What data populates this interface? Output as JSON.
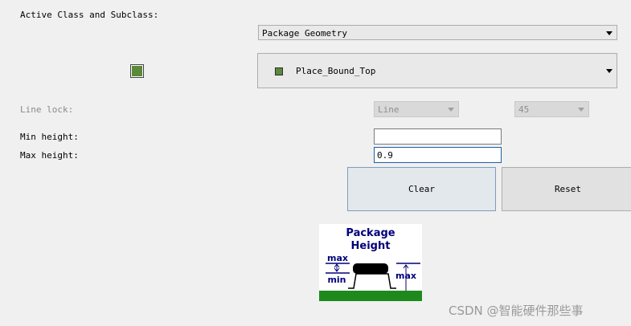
{
  "labels": {
    "active_class": "Active Class and Subclass:",
    "line_lock": "Line lock:",
    "min_height": "Min height:",
    "max_height": "Max height:"
  },
  "class_combo": {
    "value": "Package Geometry"
  },
  "subclass_combo": {
    "value": "Place_Bound_Top"
  },
  "line_lock_combo": {
    "value": "Line"
  },
  "angle_combo": {
    "value": "45"
  },
  "min_height_field": {
    "value": ""
  },
  "max_height_field": {
    "value": "0.9"
  },
  "buttons": {
    "clear": "Clear",
    "reset": "Reset"
  },
  "diagram": {
    "title_line1": "Package",
    "title_line2": "Height",
    "max_left": "max",
    "min_left": "min",
    "max_right": "max"
  },
  "colors": {
    "subclass_swatch": "#5a8a3a",
    "diagram_text": "#00007a",
    "ground": "#1e8a1e"
  },
  "watermark": "CSDN @智能硬件那些事"
}
